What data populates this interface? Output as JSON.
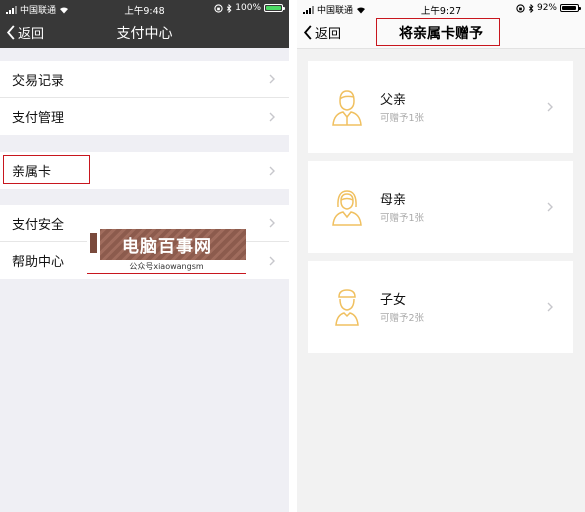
{
  "colors": {
    "accent_highlight": "#c8161e",
    "avatar_yellow": "#f0c060",
    "battery_green": "#4cd964"
  },
  "left_screen": {
    "status": {
      "carrier": "中国联通",
      "time": "上午9:48",
      "battery": "100%",
      "battery_level": 1.0
    },
    "navbar": {
      "back_label": "返回",
      "title": "支付中心"
    },
    "groups": [
      {
        "items": [
          {
            "label": "交易记录"
          },
          {
            "label": "支付管理"
          }
        ]
      },
      {
        "items": [
          {
            "label": "亲属卡"
          }
        ]
      },
      {
        "items": [
          {
            "label": "支付安全"
          },
          {
            "label": "帮助中心"
          }
        ]
      }
    ]
  },
  "watermark": {
    "title": "电脑百事网",
    "subtitle": "公众号xiaowangsm"
  },
  "right_screen": {
    "status": {
      "carrier": "中国联通",
      "time": "上午9:27",
      "battery": "92%",
      "battery_level": 0.92
    },
    "navbar": {
      "back_label": "返回",
      "title": "将亲属卡赠予"
    },
    "members": [
      {
        "name": "父亲",
        "quota": "可赠予1张",
        "icon": "father-avatar-icon"
      },
      {
        "name": "母亲",
        "quota": "可赠予1张",
        "icon": "mother-avatar-icon"
      },
      {
        "name": "子女",
        "quota": "可赠予2张",
        "icon": "child-avatar-icon"
      }
    ]
  }
}
